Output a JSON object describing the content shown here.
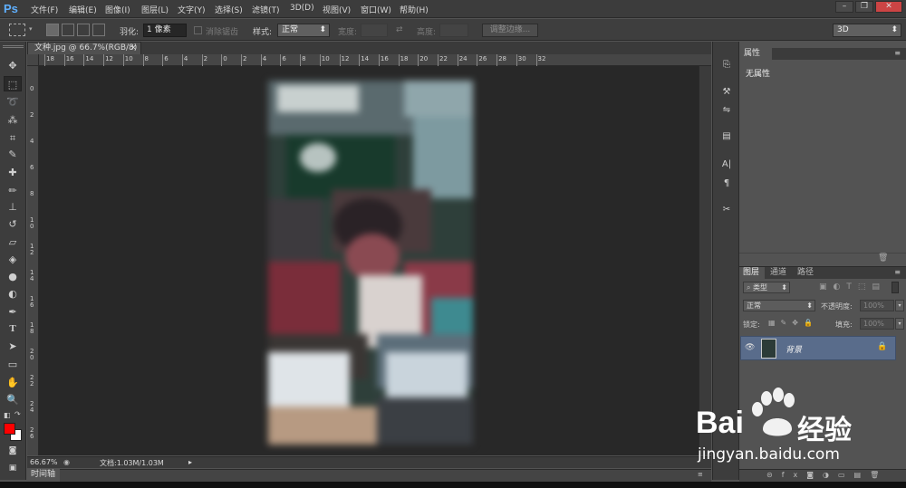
{
  "app": {
    "logo": "Ps"
  },
  "menu": [
    "文件(F)",
    "编辑(E)",
    "图像(I)",
    "图层(L)",
    "文字(Y)",
    "选择(S)",
    "滤镜(T)",
    "3D(D)",
    "视图(V)",
    "窗口(W)",
    "帮助(H)"
  ],
  "window_controls": {
    "minimize": "–",
    "restore": "❐",
    "close": "✕"
  },
  "options_bar": {
    "feather_label": "羽化:",
    "feather_value": "1 像素",
    "antialias_label": "消除锯齿",
    "style_label": "样式:",
    "style_value": "正常",
    "width_label": "宽度:",
    "height_label": "高度:",
    "refine_edge_button": "调整边缘...",
    "workspace_value": "3D"
  },
  "document": {
    "tab_title": "文种.jpg @ 66.7%(RGB/8)",
    "tab_close": "×",
    "hruler_ticks": [
      "18",
      "16",
      "14",
      "12",
      "10",
      "8",
      "6",
      "4",
      "2",
      "0",
      "2",
      "4",
      "6",
      "8",
      "10",
      "12",
      "14",
      "16",
      "18",
      "20",
      "22",
      "24",
      "26",
      "28",
      "30",
      "32"
    ],
    "vruler_ticks": [
      "0",
      "2",
      "4",
      "6",
      "8",
      "1\n0",
      "1\n2",
      "1\n4",
      "1\n6",
      "1\n8",
      "2\n0",
      "2\n2",
      "2\n4",
      "2\n6"
    ]
  },
  "status": {
    "zoom": "66.67%",
    "doc_info": "文档:1.03M/1.03M"
  },
  "timeline": {
    "label": "时间轴"
  },
  "properties": {
    "tab": "属性",
    "content": "无属性"
  },
  "layers": {
    "tabs": [
      "图层",
      "通道",
      "路径"
    ],
    "filter_kind": "类型",
    "blend_mode": "正常",
    "opacity_label": "不透明度:",
    "opacity_value": "100%",
    "lock_label": "锁定:",
    "fill_label": "填充:",
    "fill_value": "100%",
    "layer_name": "背景"
  },
  "watermark": {
    "brand": "Bai",
    "brand2": "经验",
    "url": "jingyan.baidu.com"
  },
  "colors": {
    "foreground": "#ff0000",
    "background": "#ffffff",
    "accent": "#596c8b"
  }
}
